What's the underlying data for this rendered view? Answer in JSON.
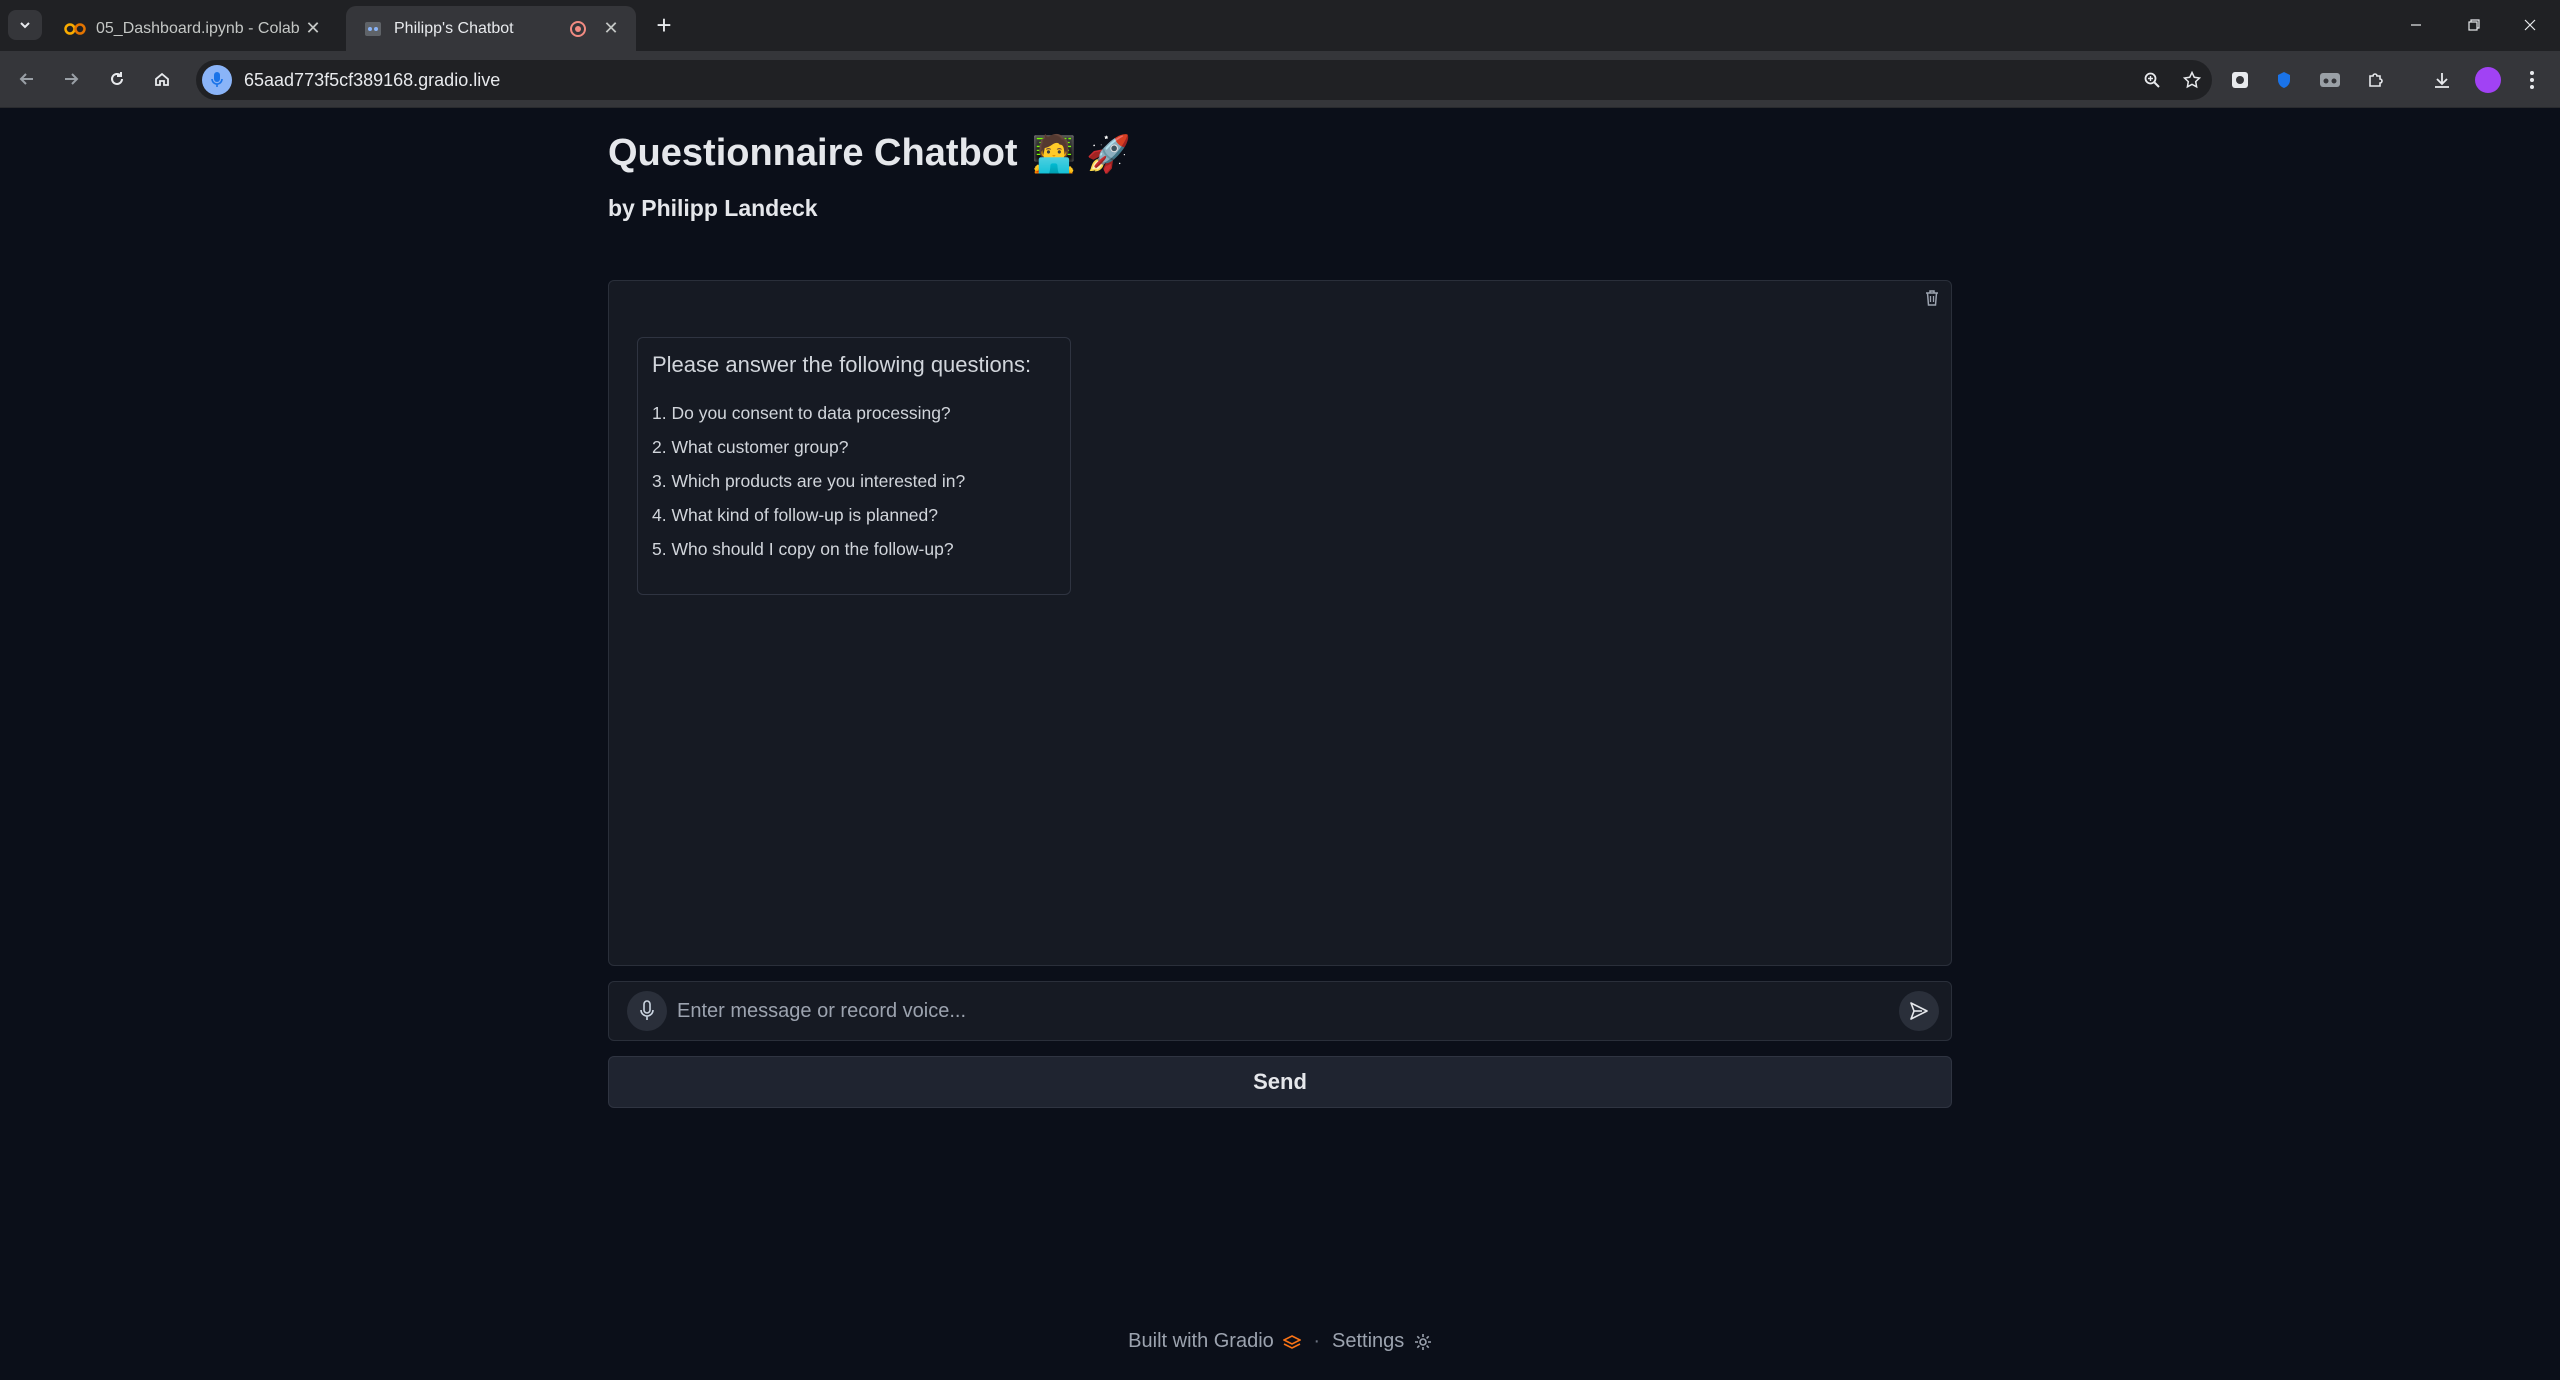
{
  "browser": {
    "tabs": [
      {
        "title": "05_Dashboard.ipynb - Colab",
        "favicon": "colab-icon",
        "active": false
      },
      {
        "title": "Philipp's Chatbot",
        "favicon": "gradio-icon",
        "active": true
      }
    ],
    "url": "65aad773f5cf389168.gradio.live"
  },
  "app": {
    "title": "Questionnaire Chatbot",
    "title_emojis": "🧑‍💻 🚀",
    "subtitle": "by Philipp Landeck"
  },
  "chat": {
    "messages": [
      {
        "intro": "Please answer the following questions:",
        "questions": [
          "1. Do you consent to data processing?",
          "2. What customer group?",
          "3. Which products are you interested in?",
          "4. What kind of follow-up is planned?",
          "5. Who should I copy on the follow-up?"
        ]
      }
    ]
  },
  "input": {
    "placeholder": "Enter message or record voice...",
    "value": ""
  },
  "send_label": "Send",
  "footer": {
    "built_with": "Built with Gradio",
    "separator": "·",
    "settings": "Settings"
  },
  "colors": {
    "background": "#0b0f19",
    "panel": "#161a23",
    "border": "#2a2f3a",
    "gradio_orange": "#f97316"
  }
}
